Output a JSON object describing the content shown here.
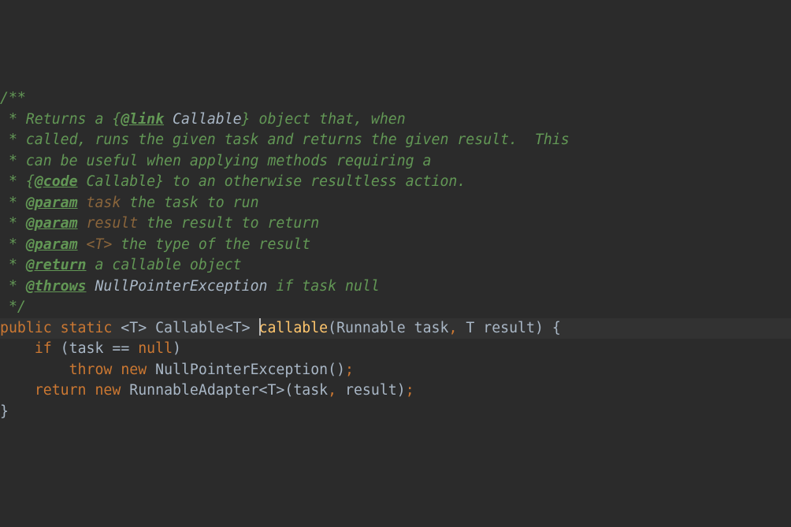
{
  "c": {
    "open": "/**",
    "l1a": " * Returns a {",
    "l1tag": "@link",
    "l1b": " ",
    "l1ref": "Callable",
    "l1c": "} object that, when",
    "l2": " * called, runs the given task and returns the given result.  This",
    "l3": " * can be useful when applying methods requiring a",
    "l4a": " * {",
    "l4tag": "@code",
    "l4b": " Callable} to an otherwise resultless action.",
    "l5a": " * ",
    "l5tag": "@param",
    "l5b": " ",
    "l5name": "task",
    "l5c": " the task to run",
    "l6a": " * ",
    "l6tag": "@param",
    "l6b": " ",
    "l6name": "result",
    "l6c": " the result to return",
    "l7a": " * ",
    "l7tag": "@param",
    "l7b": " ",
    "l7name": "<T>",
    "l7c": " the type of the result",
    "l8a": " * ",
    "l8tag": "@return",
    "l8b": " a callable object",
    "l9a": " * ",
    "l9tag": "@throws",
    "l9b": " ",
    "l9ref": "NullPointerException",
    "l9c": " if task null",
    "close": " */"
  },
  "code": {
    "sig_kw1": "public",
    "sig_sp1": " ",
    "sig_kw2": "static",
    "sig_gen": " <T> Callable<T> ",
    "sig_fn": "callable",
    "sig_args": "(Runnable task",
    "sig_kw3": ",",
    "sig_t": " T result) {",
    "if_ind": "    ",
    "if_kw": "if",
    "if_cond": " (task == ",
    "if_null": "null",
    "if_end": ")",
    "thr_ind": "        ",
    "thr_kw1": "throw",
    "thr_sp": " ",
    "thr_kw2": "new",
    "thr_rest": " NullPointerException()",
    "thr_semi": ";",
    "ret_ind": "    ",
    "ret_kw1": "return",
    "ret_sp": " ",
    "ret_kw2": "new",
    "ret_rest": " RunnableAdapter<T>(task",
    "ret_c": ",",
    "ret_rest2": " result)",
    "ret_semi": ";",
    "brace": "}"
  }
}
